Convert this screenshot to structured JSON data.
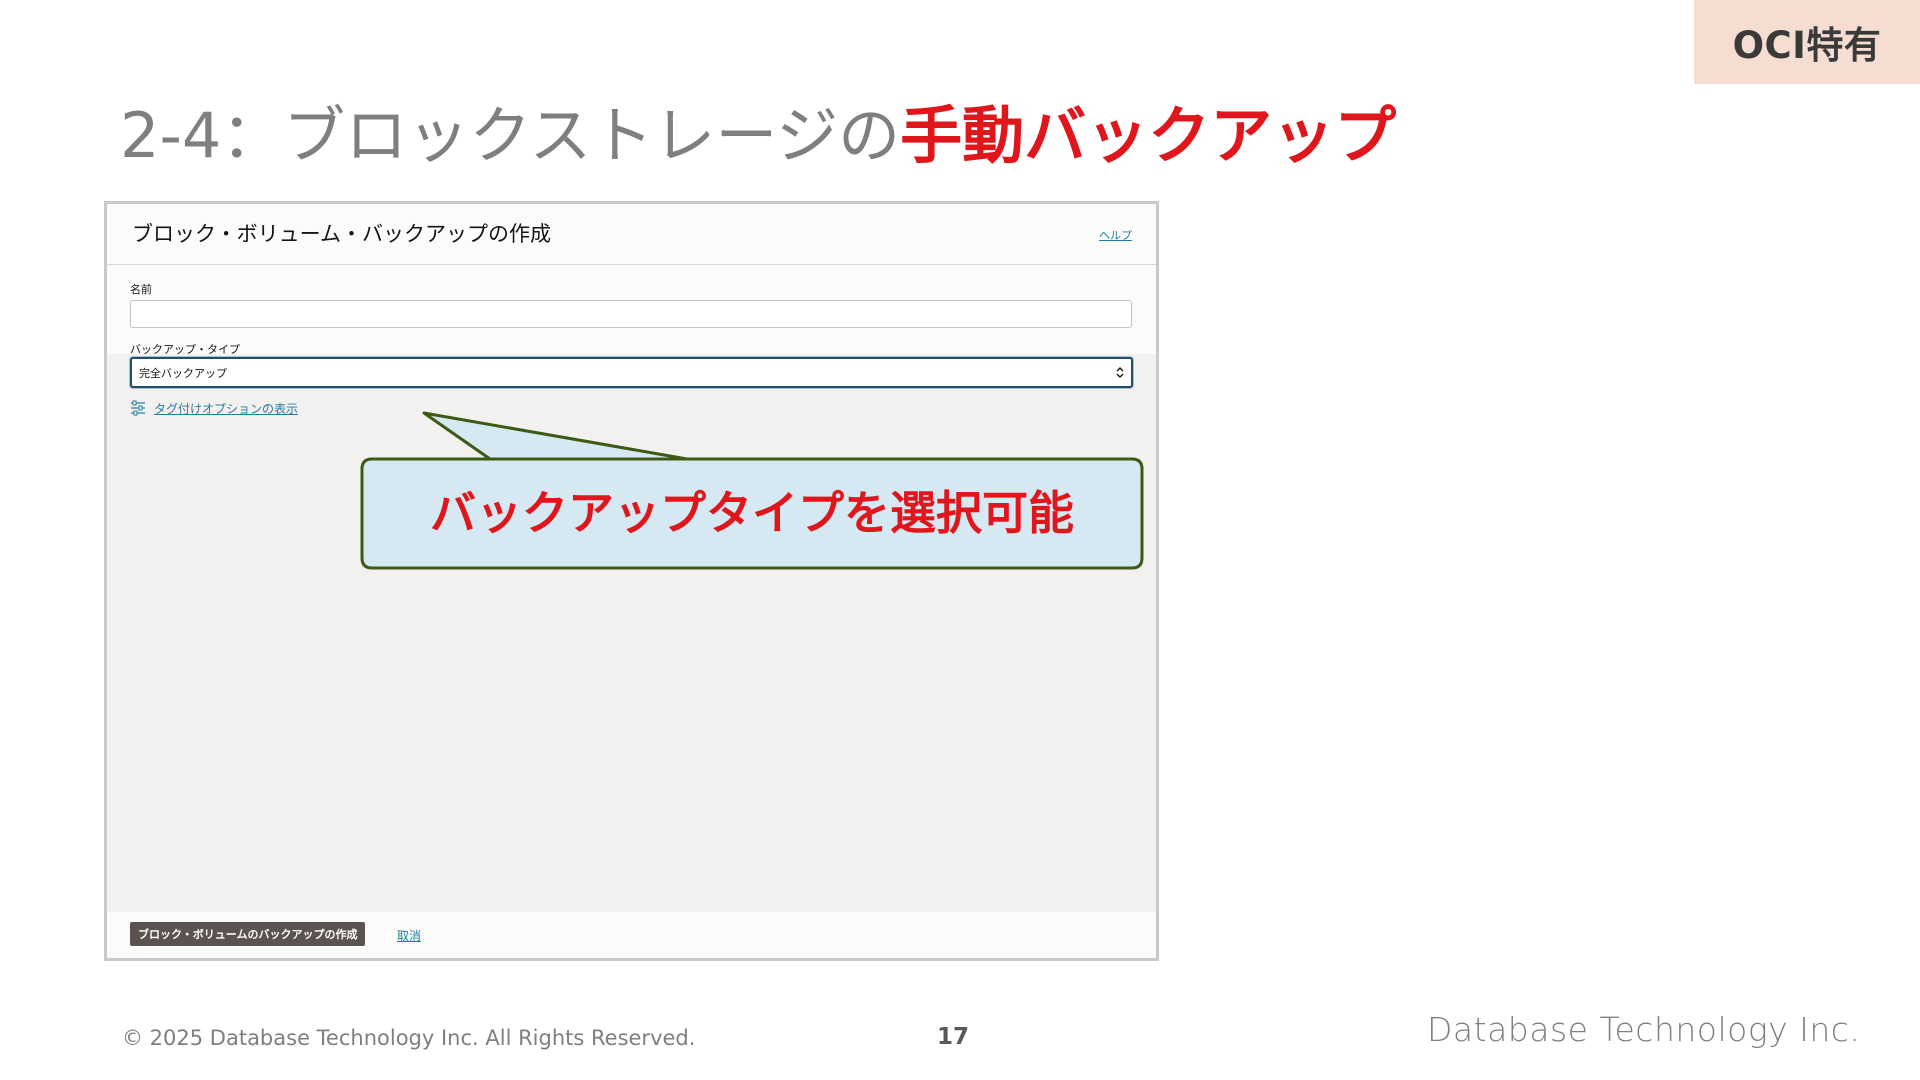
{
  "badge": {
    "label": "OCI特有"
  },
  "slide": {
    "title_prefix": "2-4：ブロックストレージの",
    "title_accent": "手動バックアップ",
    "title_accent_color": "#e0161d"
  },
  "dialog": {
    "title": "ブロック・ボリューム・バックアップの作成",
    "help_label": "ヘルプ",
    "name_label": "名前",
    "name_value": "",
    "backup_type_label": "バックアップ・タイプ",
    "backup_type_selected": "完全バックアップ",
    "tag_options_label": "タグ付けオプションの表示",
    "create_button_label": "ブロック・ボリュームのバックアップの作成",
    "cancel_label": "取消",
    "link_color": "#227e9e"
  },
  "callout": {
    "text": "バックアップタイプを選択可能",
    "fill_color": "#d6e8f2",
    "border_color": "#3d5a14"
  },
  "footer": {
    "copyright": "© 2025 Database Technology Inc. All Rights Reserved.",
    "page_number": "17",
    "company": "Database Technology Inc."
  }
}
